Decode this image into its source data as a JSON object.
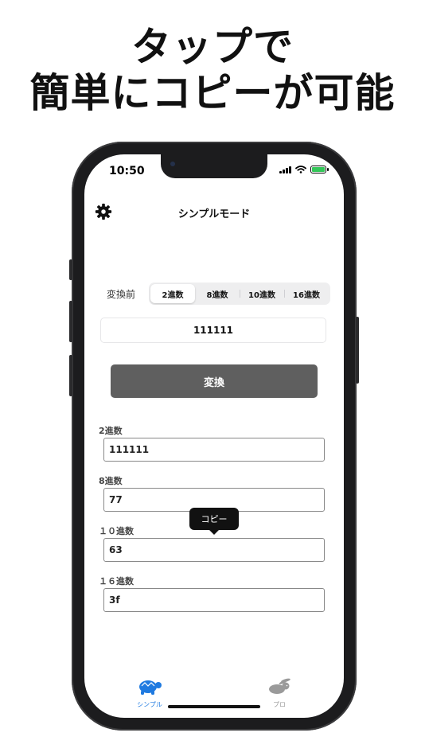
{
  "headline": {
    "line1": "タップで",
    "line2": "簡単にコピーが可能"
  },
  "status_bar": {
    "time": "10:50"
  },
  "nav": {
    "title": "シンプルモード",
    "settings_icon": "gear-icon"
  },
  "converter": {
    "before_label": "変換前",
    "segments": [
      "2進数",
      "8進数",
      "10進数",
      "16進数"
    ],
    "selected_segment": "2進数",
    "input_value": "111111",
    "convert_button": "変換"
  },
  "results": [
    {
      "label": "2進数",
      "value": "111111"
    },
    {
      "label": "8進数",
      "value": "77"
    },
    {
      "label": "１０進数",
      "value": "63"
    },
    {
      "label": "１６進数",
      "value": "3f"
    }
  ],
  "tooltip": {
    "text": "コピー"
  },
  "tab_bar": {
    "items": [
      {
        "label": "シンプル",
        "icon": "turtle-icon",
        "active": true
      },
      {
        "label": "プロ",
        "icon": "rabbit-icon",
        "active": false
      }
    ]
  },
  "colors": {
    "accent": "#1f7ae0",
    "inactive": "#9a9a9a",
    "button": "#5f5f5f",
    "battery": "#34c759"
  }
}
